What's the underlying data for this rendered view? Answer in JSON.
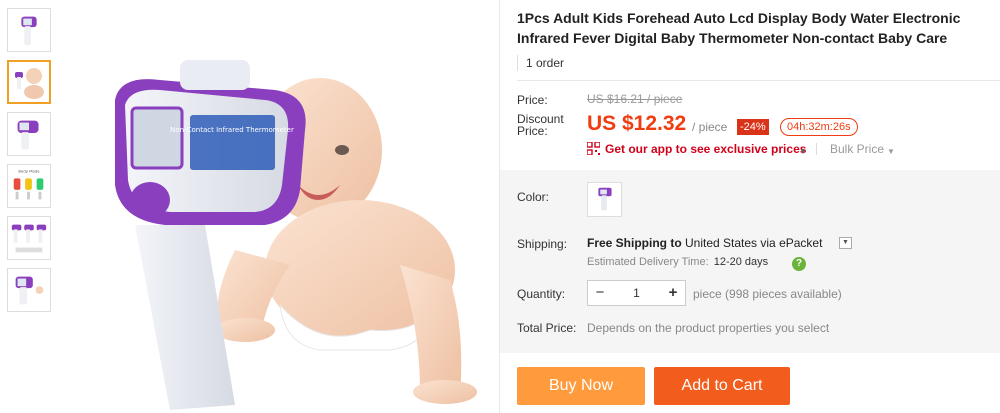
{
  "product": {
    "title": "1Pcs Adult Kids Forehead Auto Lcd Display Body Water Electronic Infrared Fever Digital Baby Thermometer Non-contact Baby Care",
    "orders": "1 order"
  },
  "gallery": {
    "thumbnails": [
      "thermometer-purple",
      "baby-with-thermometer",
      "thermometer-side",
      "body-mode-chart",
      "thermometer-set",
      "thermometer-front"
    ],
    "active_index": 1,
    "device_screen_text": "Non-Contact Infrared Thermometer"
  },
  "price": {
    "label": "Price:",
    "original": "US $16.21 / piece",
    "discount_label": "Discount Price:",
    "current": "US $12.32",
    "per_unit": "/ piece",
    "discount_badge": "-24%",
    "timer": "04h:32m:26s",
    "app_promo": "Get our app to see exclusive prices",
    "bulk": "Bulk Price"
  },
  "options": {
    "color_label": "Color:",
    "shipping_label": "Shipping:",
    "shipping_bold": "Free Shipping to",
    "shipping_dest": "United States via ePacket",
    "est_label": "Estimated Delivery Time:",
    "est_days": "12-20 days",
    "quantity_label": "Quantity:",
    "quantity": "1",
    "qty_minus": "−",
    "qty_plus": "+",
    "availability": "piece (998 pieces available)",
    "total_label": "Total Price:",
    "total_text": "Depends on the product properties you select"
  },
  "actions": {
    "buy_now": "Buy Now",
    "add_to_cart": "Add to Cart"
  },
  "colors": {
    "accent_price": "#f03c10",
    "buy_now": "#ff9a3d",
    "add_to_cart": "#f25d1d",
    "device_purple": "#8a3fbf"
  }
}
